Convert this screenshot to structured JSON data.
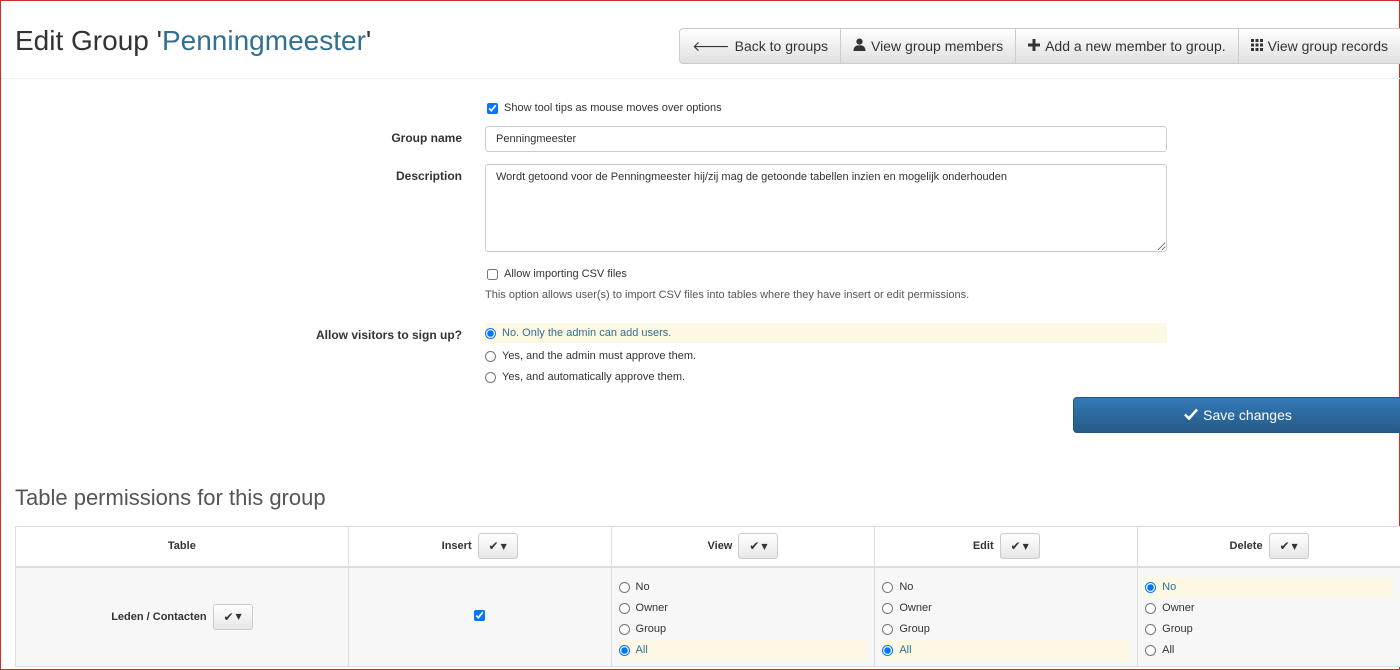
{
  "header": {
    "title_prefix": "Edit Group '",
    "group_name": "Penningmeester",
    "title_suffix": "'",
    "buttons": [
      {
        "label": "Back to groups",
        "icon": "arrow-left-icon"
      },
      {
        "label": "View group members",
        "icon": "user-icon"
      },
      {
        "label": "Add a new member to group.",
        "icon": "plus-icon"
      },
      {
        "label": "View group records",
        "icon": "grid-icon"
      }
    ]
  },
  "form": {
    "tooltips_label": "Show tool tips as mouse moves over options",
    "tooltips_checked": true,
    "group_name_label": "Group name",
    "group_name_value": "Penningmeester",
    "description_label": "Description",
    "description_value": "Wordt getoond voor de Penningmeester hij/zij mag de getoonde tabellen inzien en mogelijk onderhouden",
    "csv_label": "Allow importing CSV files",
    "csv_checked": false,
    "csv_hint": "This option allows user(s) to import CSV files into tables where they have insert or edit permissions.",
    "signup_label": "Allow visitors to sign up?",
    "signup_options": [
      "No. Only the admin can add users.",
      "Yes, and the admin must approve them.",
      "Yes, and automatically approve them."
    ],
    "signup_selected": 0,
    "save_label": "Save changes"
  },
  "permissions": {
    "section_title": "Table permissions for this group",
    "columns": [
      "Table",
      "Insert",
      "View",
      "Edit",
      "Delete"
    ],
    "rows": [
      {
        "table": "Leden / Contacten",
        "insert": true,
        "view": {
          "options": [
            "No",
            "Owner",
            "Group",
            "All"
          ],
          "selected": 3
        },
        "edit": {
          "options": [
            "No",
            "Owner",
            "Group",
            "All"
          ],
          "selected": 3
        },
        "delete": {
          "options": [
            "No",
            "Owner",
            "Group",
            "All"
          ],
          "selected": 0
        }
      }
    ]
  }
}
